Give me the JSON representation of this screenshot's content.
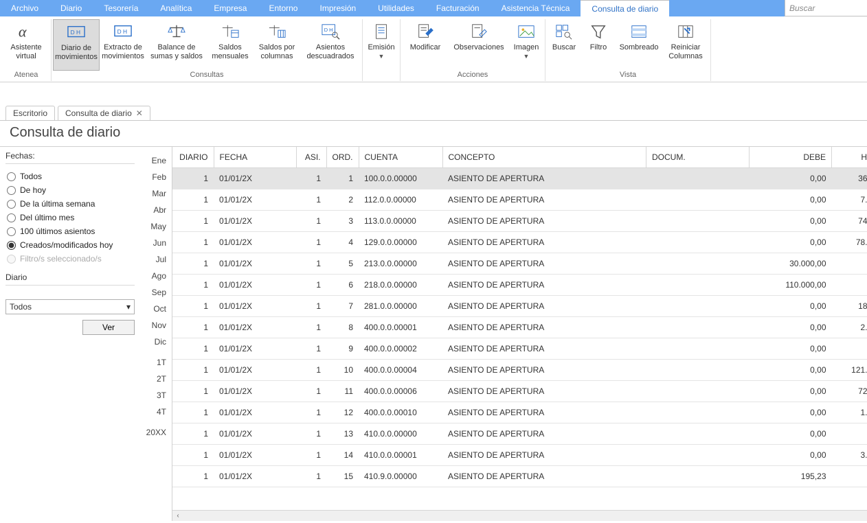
{
  "menu": {
    "items": [
      "Archivo",
      "Diario",
      "Tesorería",
      "Analítica",
      "Empresa",
      "Entorno",
      "Impresión",
      "Utilidades",
      "Facturación",
      "Asistencia Técnica",
      "Consulta de diario"
    ],
    "active_index": 10,
    "search_placeholder": "Buscar"
  },
  "ribbon": {
    "groups": [
      {
        "title": "Atenea",
        "buttons": [
          {
            "name": "asistente-virtual",
            "label": "Asistente\nvirtual",
            "icon": "alpha"
          }
        ]
      },
      {
        "title": "Consultas",
        "buttons": [
          {
            "name": "diario-movimientos",
            "label": "Diario de\nmovimientos",
            "icon": "dh",
            "active": true
          },
          {
            "name": "extracto-movimientos",
            "label": "Extracto de\nmovimientos",
            "icon": "dh"
          },
          {
            "name": "balance-sumas-saldos",
            "label": "Balance de\nsumas y saldos",
            "icon": "scale",
            "wide": true
          },
          {
            "name": "saldos-mensuales",
            "label": "Saldos\nmensuales",
            "icon": "scale-cal"
          },
          {
            "name": "saldos-columnas",
            "label": "Saldos por\ncolumnas",
            "icon": "scale-cols"
          },
          {
            "name": "asientos-descuadrados",
            "label": "Asientos\ndescuadrados",
            "icon": "dh-search",
            "wide": true
          }
        ]
      },
      {
        "title": "",
        "buttons": [
          {
            "name": "emision",
            "label": "Emisión",
            "icon": "doc",
            "dropdown": true,
            "narrow": true
          }
        ]
      },
      {
        "title": "Acciones",
        "buttons": [
          {
            "name": "modificar",
            "label": "Modificar",
            "icon": "doc-edit"
          },
          {
            "name": "observaciones",
            "label": "Observaciones",
            "icon": "doc-note",
            "wide": true
          },
          {
            "name": "imagen",
            "label": "Imagen",
            "icon": "image",
            "dropdown": true,
            "narrow": true
          }
        ]
      },
      {
        "title": "Vista",
        "buttons": [
          {
            "name": "buscar",
            "label": "Buscar",
            "icon": "find",
            "narrow": true
          },
          {
            "name": "filtro",
            "label": "Filtro",
            "icon": "funnel",
            "narrow": true
          },
          {
            "name": "sombreado",
            "label": "Sombreado",
            "icon": "shade"
          },
          {
            "name": "reiniciar-columnas",
            "label": "Reiniciar\nColumnas",
            "icon": "reset-cols"
          }
        ]
      }
    ]
  },
  "tabs": {
    "items": [
      {
        "label": "Escritorio",
        "closable": false
      },
      {
        "label": "Consulta de diario",
        "closable": true
      }
    ]
  },
  "page": {
    "title": "Consulta de diario"
  },
  "filters": {
    "heading": "Fechas:",
    "options": [
      {
        "label": "Todos",
        "checked": false
      },
      {
        "label": "De hoy",
        "checked": false
      },
      {
        "label": "De la última semana",
        "checked": false
      },
      {
        "label": "Del último mes",
        "checked": false
      },
      {
        "label": "100 últimos asientos",
        "checked": false
      },
      {
        "label": "Creados/modificados hoy",
        "checked": true
      },
      {
        "label": "Filtro/s seleccionado/s",
        "checked": false,
        "disabled": true
      }
    ],
    "diario_heading": "Diario",
    "diario_value": "Todos",
    "ver_button": "Ver"
  },
  "periods": [
    "Ene",
    "Feb",
    "Mar",
    "Abr",
    "May",
    "Jun",
    "Jul",
    "Ago",
    "Sep",
    "Oct",
    "Nov",
    "Dic",
    "",
    "1T",
    "2T",
    "3T",
    "4T",
    "",
    "20XX"
  ],
  "grid": {
    "columns": [
      {
        "key": "diario",
        "label": "DIARIO",
        "align": "right"
      },
      {
        "key": "fecha",
        "label": "FECHA",
        "align": "left"
      },
      {
        "key": "asi",
        "label": "ASI.",
        "align": "right"
      },
      {
        "key": "ord",
        "label": "ORD.",
        "align": "right"
      },
      {
        "key": "cuenta",
        "label": "CUENTA",
        "align": "left"
      },
      {
        "key": "concepto",
        "label": "CONCEPTO",
        "align": "left"
      },
      {
        "key": "docum",
        "label": "DOCUM.",
        "align": "left"
      },
      {
        "key": "debe",
        "label": "DEBE",
        "align": "right"
      },
      {
        "key": "haber",
        "label": "H",
        "align": "right"
      }
    ],
    "rows": [
      {
        "diario": "1",
        "fecha": "01/01/2X",
        "asi": "1",
        "ord": "1",
        "cuenta": "100.0.0.00000",
        "concepto": "ASIENTO DE APERTURA",
        "docum": "",
        "debe": "0,00",
        "haber": "36",
        "selected": true
      },
      {
        "diario": "1",
        "fecha": "01/01/2X",
        "asi": "1",
        "ord": "2",
        "cuenta": "112.0.0.00000",
        "concepto": "ASIENTO DE APERTURA",
        "docum": "",
        "debe": "0,00",
        "haber": "7."
      },
      {
        "diario": "1",
        "fecha": "01/01/2X",
        "asi": "1",
        "ord": "3",
        "cuenta": "113.0.0.00000",
        "concepto": "ASIENTO DE APERTURA",
        "docum": "",
        "debe": "0,00",
        "haber": "74"
      },
      {
        "diario": "1",
        "fecha": "01/01/2X",
        "asi": "1",
        "ord": "4",
        "cuenta": "129.0.0.00000",
        "concepto": "ASIENTO DE APERTURA",
        "docum": "",
        "debe": "0,00",
        "haber": "78."
      },
      {
        "diario": "1",
        "fecha": "01/01/2X",
        "asi": "1",
        "ord": "5",
        "cuenta": "213.0.0.00000",
        "concepto": "ASIENTO DE APERTURA",
        "docum": "",
        "debe": "30.000,00",
        "haber": ""
      },
      {
        "diario": "1",
        "fecha": "01/01/2X",
        "asi": "1",
        "ord": "6",
        "cuenta": "218.0.0.00000",
        "concepto": "ASIENTO DE APERTURA",
        "docum": "",
        "debe": "110.000,00",
        "haber": ""
      },
      {
        "diario": "1",
        "fecha": "01/01/2X",
        "asi": "1",
        "ord": "7",
        "cuenta": "281.0.0.00000",
        "concepto": "ASIENTO DE APERTURA",
        "docum": "",
        "debe": "0,00",
        "haber": "18"
      },
      {
        "diario": "1",
        "fecha": "01/01/2X",
        "asi": "1",
        "ord": "8",
        "cuenta": "400.0.0.00001",
        "concepto": "ASIENTO DE APERTURA",
        "docum": "",
        "debe": "0,00",
        "haber": "2."
      },
      {
        "diario": "1",
        "fecha": "01/01/2X",
        "asi": "1",
        "ord": "9",
        "cuenta": "400.0.0.00002",
        "concepto": "ASIENTO DE APERTURA",
        "docum": "",
        "debe": "0,00",
        "haber": ""
      },
      {
        "diario": "1",
        "fecha": "01/01/2X",
        "asi": "1",
        "ord": "10",
        "cuenta": "400.0.0.00004",
        "concepto": "ASIENTO DE APERTURA",
        "docum": "",
        "debe": "0,00",
        "haber": "121."
      },
      {
        "diario": "1",
        "fecha": "01/01/2X",
        "asi": "1",
        "ord": "11",
        "cuenta": "400.0.0.00006",
        "concepto": "ASIENTO DE APERTURA",
        "docum": "",
        "debe": "0,00",
        "haber": "72"
      },
      {
        "diario": "1",
        "fecha": "01/01/2X",
        "asi": "1",
        "ord": "12",
        "cuenta": "400.0.0.00010",
        "concepto": "ASIENTO DE APERTURA",
        "docum": "",
        "debe": "0,00",
        "haber": "1."
      },
      {
        "diario": "1",
        "fecha": "01/01/2X",
        "asi": "1",
        "ord": "13",
        "cuenta": "410.0.0.00000",
        "concepto": "ASIENTO DE APERTURA",
        "docum": "",
        "debe": "0,00",
        "haber": ""
      },
      {
        "diario": "1",
        "fecha": "01/01/2X",
        "asi": "1",
        "ord": "14",
        "cuenta": "410.0.0.00001",
        "concepto": "ASIENTO DE APERTURA",
        "docum": "",
        "debe": "0,00",
        "haber": "3."
      },
      {
        "diario": "1",
        "fecha": "01/01/2X",
        "asi": "1",
        "ord": "15",
        "cuenta": "410.9.0.00000",
        "concepto": "ASIENTO DE APERTURA",
        "docum": "",
        "debe": "195,23",
        "haber": ""
      }
    ]
  }
}
